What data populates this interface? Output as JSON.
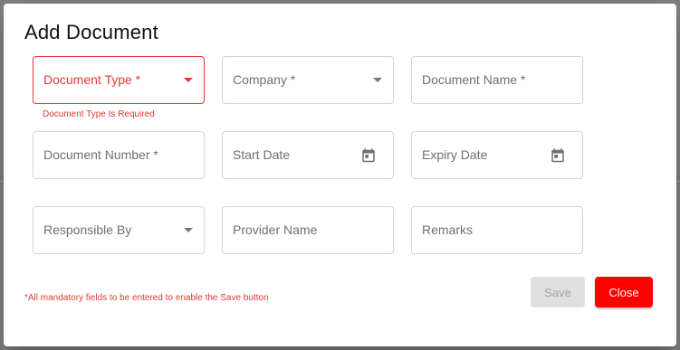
{
  "dialog": {
    "title": "Add Document"
  },
  "fields": {
    "document_type": {
      "label": "Document Type *",
      "error": "Document Type Is Required"
    },
    "company": {
      "label": "Company *"
    },
    "document_name": {
      "label": "Document Name *"
    },
    "document_number": {
      "label": "Document Number *"
    },
    "start_date": {
      "label": "Start Date"
    },
    "expiry_date": {
      "label": "Expiry Date"
    },
    "responsible_by": {
      "label": "Responsible By"
    },
    "provider_name": {
      "label": "Provider Name"
    },
    "remarks": {
      "label": "Remarks"
    }
  },
  "footer": {
    "note": "*All mandatory fields to be entered to enable the Save button",
    "save_label": "Save",
    "close_label": "Close"
  },
  "colors": {
    "error": "#e53935",
    "close_button": "#ff0000",
    "save_disabled": "#e0e0e0",
    "field_border": "#d4d4d4"
  },
  "icons": {
    "dropdown": "caret-down-icon",
    "date": "calendar-icon"
  }
}
